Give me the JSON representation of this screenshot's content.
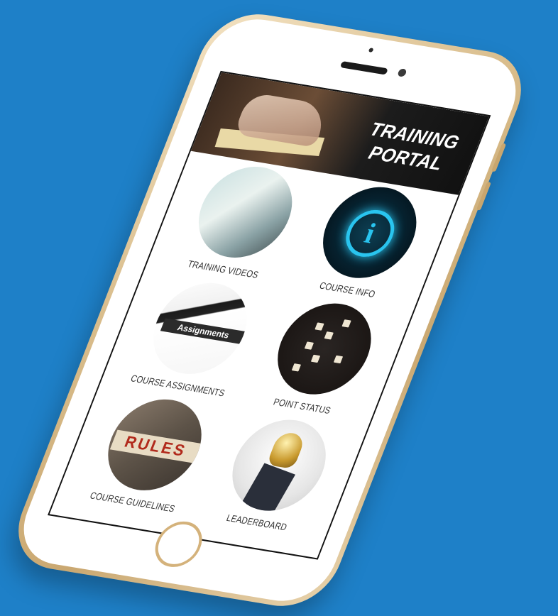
{
  "banner": {
    "title_line1": "TRAINING",
    "title_line2": "PORTAL"
  },
  "tiles": [
    {
      "label": "TRAINING VIDEOS",
      "image": "laptop-desk-photo"
    },
    {
      "label": "COURSE INFO",
      "image": "info-icon-photo"
    },
    {
      "label": "COURSE ASSIGNMENTS",
      "image": "assignments-paper-photo",
      "image_text": "Assignments"
    },
    {
      "label": "POINT STATUS",
      "image": "scattered-tiles-photo"
    },
    {
      "label": "COURSE GUIDELINES",
      "image": "rules-blocks-photo",
      "image_text": "RULES"
    },
    {
      "label": "LEADERBOARD",
      "image": "trophy-photo"
    }
  ],
  "colors": {
    "background": "#1e80c8",
    "phone_gold": "#d9bd8c",
    "info_glow": "#29c4ef"
  }
}
